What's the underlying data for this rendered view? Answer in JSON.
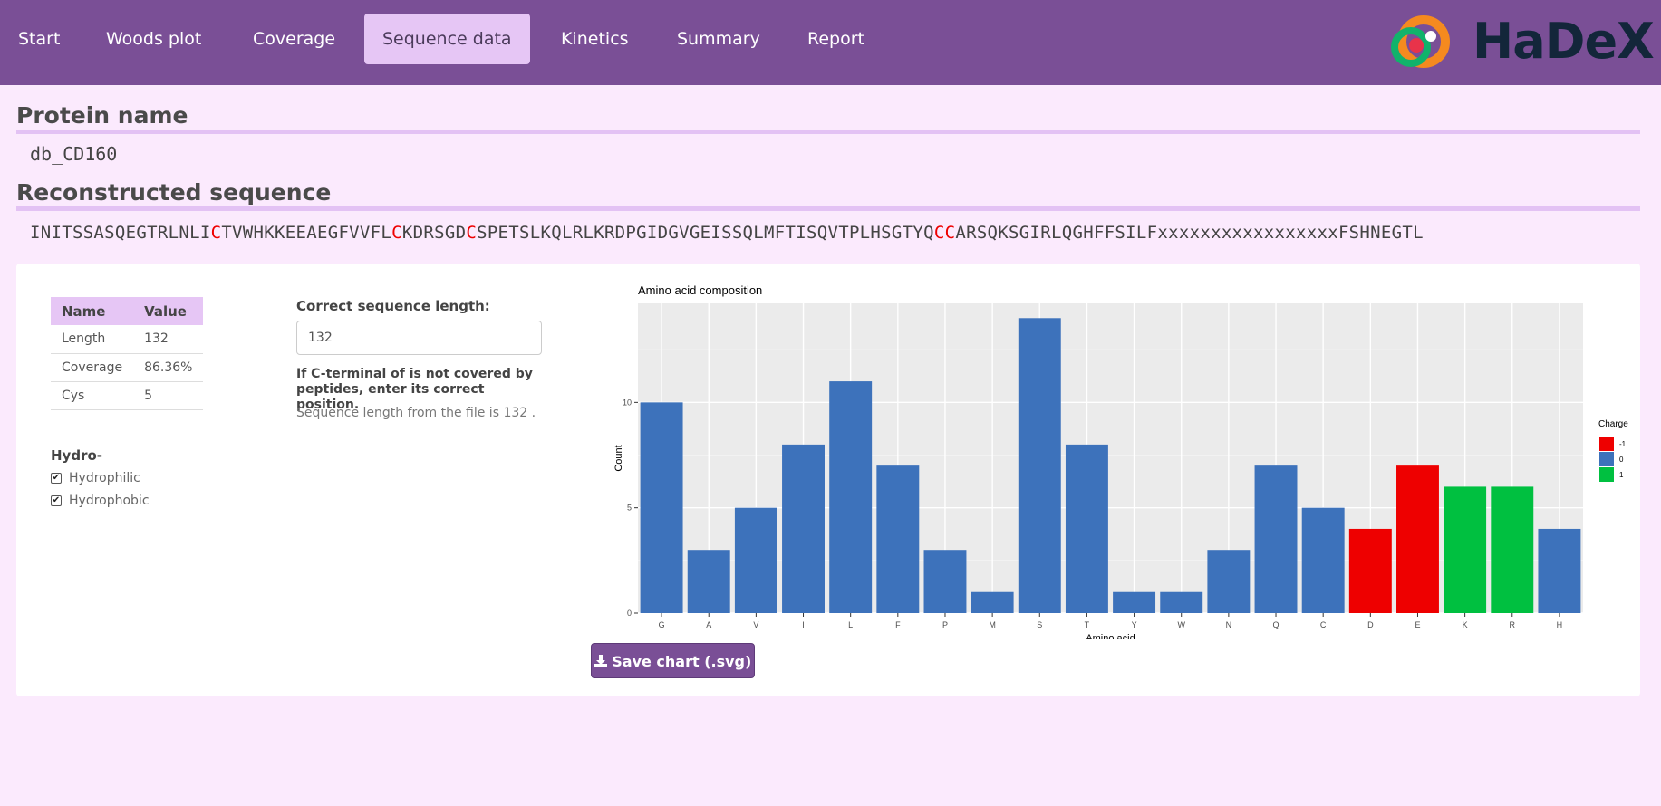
{
  "nav": {
    "tabs": [
      "Start",
      "Woods plot",
      "Coverage",
      "Sequence data",
      "Kinetics",
      "Summary",
      "Report"
    ],
    "active_index": 3,
    "logo_text": "HaDeX"
  },
  "protein": {
    "title": "Protein name",
    "name": "db_CD160"
  },
  "sequence": {
    "title": "Reconstructed sequence",
    "parts": [
      {
        "text": "INITSSASQEGTRLNLI",
        "hl": false
      },
      {
        "text": "C",
        "hl": true
      },
      {
        "text": "TVWHKKEEAEGFVVFL",
        "hl": false
      },
      {
        "text": "C",
        "hl": true
      },
      {
        "text": "KDRSGD",
        "hl": false
      },
      {
        "text": "C",
        "hl": true
      },
      {
        "text": "SPETSLKQLRLKRDPGIDGVGEISSQLMFTISQVTPLHSGTYQ",
        "hl": false
      },
      {
        "text": "CC",
        "hl": true
      },
      {
        "text": "ARSQKSGIRLQGHFFSILFxxxxxxxxxxxxxxxxxFSHNEGTL",
        "hl": false
      }
    ],
    "highlight_color": "#ee0000"
  },
  "stats": {
    "headers": [
      "Name",
      "Value"
    ],
    "rows": [
      {
        "name": "Length",
        "value": "132"
      },
      {
        "name": "Coverage",
        "value": "86.36%"
      },
      {
        "name": "Cys",
        "value": "5"
      }
    ]
  },
  "hydro": {
    "title": "Hydro-",
    "options": [
      {
        "label": "Hydrophilic",
        "checked": true
      },
      {
        "label": "Hydrophobic",
        "checked": true
      }
    ]
  },
  "length_input": {
    "label": "Correct sequence length:",
    "value": "132",
    "note": "If C-terminal of is not covered by peptides, enter its correct position.",
    "file_note": "Sequence length from the file is 132 ."
  },
  "chart_data": {
    "type": "bar",
    "title": "Amino acid composition",
    "xlabel": "Amino acid",
    "ylabel": "Count",
    "categories": [
      "G",
      "A",
      "V",
      "I",
      "L",
      "F",
      "P",
      "M",
      "S",
      "T",
      "Y",
      "W",
      "N",
      "Q",
      "C",
      "D",
      "E",
      "K",
      "R",
      "H"
    ],
    "values": [
      10,
      3,
      5,
      8,
      11,
      7,
      3,
      1,
      14,
      8,
      1,
      1,
      3,
      7,
      5,
      4,
      7,
      6,
      6,
      4
    ],
    "charge": [
      0,
      0,
      0,
      0,
      0,
      0,
      0,
      0,
      0,
      0,
      0,
      0,
      0,
      0,
      0,
      -1,
      -1,
      1,
      1,
      0
    ],
    "ylim": [
      0,
      14.7
    ],
    "yticks": [
      0,
      5,
      10
    ],
    "grid": true,
    "legend": {
      "title": "Charge",
      "position": "right",
      "entries": [
        {
          "label": "-1",
          "color": "#ee0000"
        },
        {
          "label": "0",
          "color": "#3d72bb"
        },
        {
          "label": "1",
          "color": "#00c040"
        }
      ]
    }
  },
  "save_button": {
    "label": "Save chart (.svg)",
    "icon": "download-icon"
  }
}
